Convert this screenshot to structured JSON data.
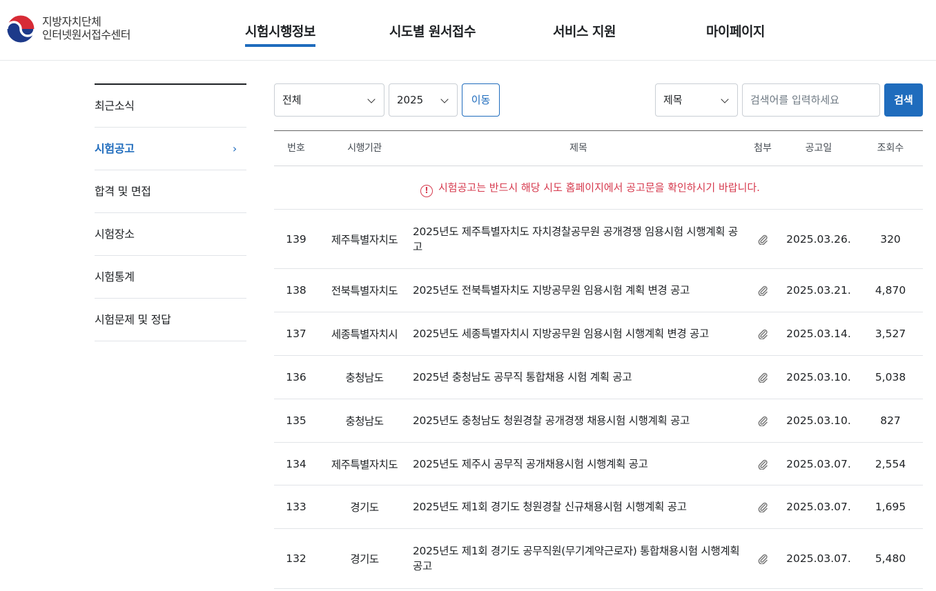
{
  "header": {
    "logo_line1": "지방자치단체",
    "logo_line2": "인터넷원서접수센터",
    "nav": [
      "시험시행정보",
      "시도별 원서접수",
      "서비스 지원",
      "마이페이지"
    ]
  },
  "sidebar": {
    "items": [
      {
        "label": "최근소식"
      },
      {
        "label": "시험공고"
      },
      {
        "label": "합격 및 면접"
      },
      {
        "label": "시험장소"
      },
      {
        "label": "시험통계"
      },
      {
        "label": "시험문제 및 정답"
      }
    ]
  },
  "filters": {
    "region": "전체",
    "year": "2025",
    "move_label": "이동",
    "search_field": "제목",
    "search_placeholder": "검색어를 입력하세요",
    "search_label": "검색"
  },
  "table": {
    "headers": [
      "번호",
      "시행기관",
      "제목",
      "첨부",
      "공고일",
      "조회수"
    ],
    "notice": "시험공고는 반드시 해당 시도 홈페이지에서 공고문을 확인하시기 바랍니다.",
    "rows": [
      {
        "no": "139",
        "org": "제주특별자치도",
        "title": "2025년도 제주특별자치도 자치경찰공무원 공개경쟁 임용시험 시행계획 공고",
        "date": "2025.03.26.",
        "views": "320"
      },
      {
        "no": "138",
        "org": "전북특별자치도",
        "title": "2025년도 전북특별자치도 지방공무원 임용시험 계획 변경 공고",
        "date": "2025.03.21.",
        "views": "4,870"
      },
      {
        "no": "137",
        "org": "세종특별자치시",
        "title": "2025년도 세종특별자치시 지방공무원 임용시험 시행계획 변경 공고",
        "date": "2025.03.14.",
        "views": "3,527"
      },
      {
        "no": "136",
        "org": "충청남도",
        "title": "2025년 충청남도 공무직 통합채용 시험 계획 공고",
        "date": "2025.03.10.",
        "views": "5,038"
      },
      {
        "no": "135",
        "org": "충청남도",
        "title": "2025년도 충청남도 청원경찰 공개경쟁 채용시험 시행계획 공고",
        "date": "2025.03.10.",
        "views": "827"
      },
      {
        "no": "134",
        "org": "제주특별자치도",
        "title": "2025년도 제주시 공무직 공개채용시험 시행계획 공고",
        "date": "2025.03.07.",
        "views": "2,554"
      },
      {
        "no": "133",
        "org": "경기도",
        "title": "2025년도 제1회 경기도 청원경찰 신규채용시험 시행계획 공고",
        "date": "2025.03.07.",
        "views": "1,695"
      },
      {
        "no": "132",
        "org": "경기도",
        "title": "2025년도 제1회 경기도 공무직원(무기계약근로자) 통합채용시험 시행계획 공고",
        "date": "2025.03.07.",
        "views": "5,480"
      }
    ]
  }
}
